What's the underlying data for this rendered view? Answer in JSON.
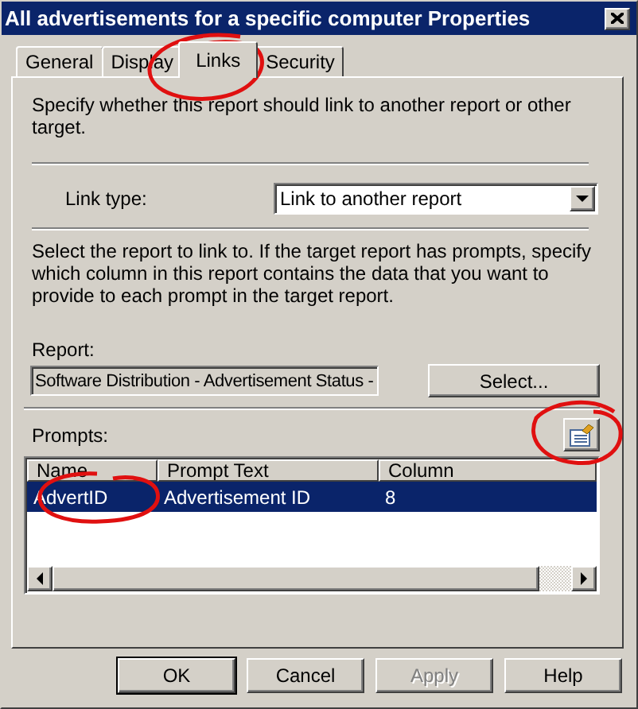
{
  "window": {
    "title": "All advertisements for a specific computer Properties"
  },
  "tabs": [
    {
      "label": "General",
      "selected": false
    },
    {
      "label": "Display",
      "selected": false
    },
    {
      "label": "Links",
      "selected": true
    },
    {
      "label": "Security",
      "selected": false
    }
  ],
  "description": "Specify whether this report should link to another report or other target.",
  "link_type": {
    "label": "Link type:",
    "value": "Link to another report"
  },
  "instructions": "Select the report to link to. If the target report has prompts, specify which column in this report contains the data that you want to provide to each prompt in the target report.",
  "report": {
    "label": "Report:",
    "value": "Software Distribution - Advertisement Status -",
    "button": "Select..."
  },
  "prompts": {
    "label": "Prompts:",
    "columns": [
      "Name",
      "Prompt Text",
      "Column"
    ],
    "rows": [
      {
        "cells": [
          "AdvertID",
          "Advertisement ID",
          "8"
        ],
        "selected": true
      }
    ]
  },
  "buttons": [
    {
      "label": "OK",
      "disabled": false,
      "default": true
    },
    {
      "label": "Cancel",
      "disabled": false,
      "default": false
    },
    {
      "label": "Apply",
      "disabled": true,
      "default": false
    },
    {
      "label": "Help",
      "disabled": false,
      "default": false
    }
  ]
}
